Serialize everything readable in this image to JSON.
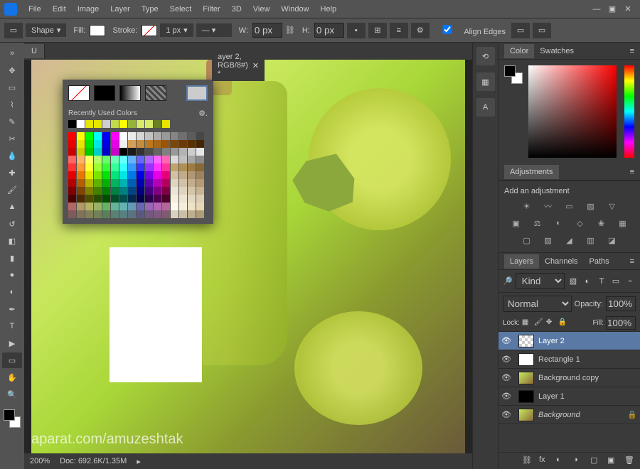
{
  "menu": {
    "items": [
      "File",
      "Edit",
      "Image",
      "Layer",
      "Type",
      "Select",
      "Filter",
      "3D",
      "View",
      "Window",
      "Help"
    ]
  },
  "options": {
    "shape_mode": "Shape",
    "fill_label": "Fill:",
    "stroke_label": "Stroke:",
    "stroke_width": "1 px",
    "w_label": "W:",
    "w_value": "0 px",
    "h_label": "H:",
    "h_value": "0 px",
    "align_edges": "Align Edges",
    "link_icon": "⛓"
  },
  "tab": {
    "title": "ayer 2, RGB/8#) *",
    "partial_prefix": "U"
  },
  "status": {
    "zoom": "200%",
    "doc": "Doc: 692.6K/1.35M"
  },
  "color_panel": {
    "tabs": [
      "Color",
      "Swatches"
    ]
  },
  "adjustments": {
    "tab": "Adjustments",
    "add_label": "Add an adjustment",
    "row1": [
      "☀",
      "〰",
      "▭",
      "▨",
      "▽"
    ],
    "row2": [
      "▣",
      "⚖",
      "◐",
      "◇",
      "❀",
      "▦"
    ],
    "row3": [
      "▢",
      "▨",
      "◢",
      "▥",
      "◪"
    ]
  },
  "layers_panel": {
    "tabs": [
      "Layers",
      "Channels",
      "Paths"
    ],
    "filter_kind": "Kind",
    "blend_mode": "Normal",
    "opacity_label": "Opacity:",
    "opacity_value": "100%",
    "lock_label": "Lock:",
    "fill_label": "Fill:",
    "fill_value": "100%",
    "layers": [
      {
        "name": "Layer 2",
        "thumb": "trans",
        "selected": true
      },
      {
        "name": "Rectangle 1",
        "thumb": "white"
      },
      {
        "name": "Background copy",
        "thumb": "img"
      },
      {
        "name": "Layer 1",
        "thumb": "dark"
      },
      {
        "name": "Background",
        "thumb": "img",
        "locked": true,
        "italic": true
      }
    ]
  },
  "color_popup": {
    "recent_label": "Recently Used Colors",
    "recent": [
      "#000000",
      "#ffffff",
      "#e6e600",
      "#e6e600",
      "#cecece",
      "#c0db4a",
      "#ffff00",
      "#95b43c",
      "#d9eb6a",
      "#d9eb6a",
      "#6a8023",
      "#e6e600"
    ],
    "palette": [
      [
        "#ff0000",
        "#ffff00",
        "#00ff00",
        "#00ffff",
        "#0000ff",
        "#ff00ff",
        "#ffffff",
        "#ebebeb",
        "#d6d6d6",
        "#c2c2c2",
        "#adadad",
        "#999999",
        "#858585",
        "#707070",
        "#5c5c5c",
        "#474747"
      ],
      [
        "#e60000",
        "#e6e600",
        "#00e600",
        "#00e6e6",
        "#0000e6",
        "#e600e6",
        "#f0f0f0",
        "#d4a056",
        "#c78d3a",
        "#b97a23",
        "#a86815",
        "#96570c",
        "#7f4608",
        "#6b3a07",
        "#573006",
        "#432505"
      ],
      [
        "#cc0000",
        "#cccc00",
        "#00cc00",
        "#00cccc",
        "#0000cc",
        "#cc00cc",
        "#000000",
        "#1a1a1a",
        "#333333",
        "#4d4d4d",
        "#666666",
        "#808080",
        "#999999",
        "#b3b3b3",
        "#cccccc",
        "#e6e6e6"
      ],
      [
        "#ff6666",
        "#ffb366",
        "#ffff66",
        "#b3ff66",
        "#66ff66",
        "#66ffb3",
        "#66ffff",
        "#66b3ff",
        "#6666ff",
        "#b366ff",
        "#ff66ff",
        "#ff66b3",
        "#d9d9d9",
        "#bfbfbf",
        "#a6a6a6",
        "#8c8c8c"
      ],
      [
        "#ff3333",
        "#ff9933",
        "#ffff33",
        "#99ff33",
        "#33ff33",
        "#33ff99",
        "#33ffff",
        "#3399ff",
        "#3333ff",
        "#9933ff",
        "#ff33ff",
        "#ff3399",
        "#c1a36a",
        "#ae8f55",
        "#9b7c43",
        "#886935"
      ],
      [
        "#e60000",
        "#e67a00",
        "#e6e600",
        "#7ae600",
        "#00e600",
        "#00e67a",
        "#00e6e6",
        "#007ae6",
        "#0000e6",
        "#7a00e6",
        "#e600e6",
        "#e6007a",
        "#d4bfa0",
        "#c2ab8a",
        "#b09775",
        "#9e8360"
      ],
      [
        "#b30000",
        "#b35f00",
        "#b3b300",
        "#5fb300",
        "#00b300",
        "#00b35f",
        "#00b3b3",
        "#005fb3",
        "#0000b3",
        "#5f00b3",
        "#b300b3",
        "#b3005f",
        "#e0d4bf",
        "#d1c1a6",
        "#c2ae8e",
        "#b39b76"
      ],
      [
        "#800000",
        "#804400",
        "#808000",
        "#448000",
        "#008000",
        "#008044",
        "#008080",
        "#004480",
        "#000080",
        "#440080",
        "#800080",
        "#800044",
        "#ece4d6",
        "#e0d4bf",
        "#d4c4a8",
        "#c8b492"
      ],
      [
        "#4d0000",
        "#4d2900",
        "#4d4d00",
        "#294d00",
        "#004d00",
        "#004d29",
        "#004d4d",
        "#00294d",
        "#00004d",
        "#29004d",
        "#4d004d",
        "#4d0029",
        "#f5efde",
        "#ece4d0",
        "#e3d9c2",
        "#dacfb4"
      ],
      [
        "#b36666",
        "#b39966",
        "#b3b366",
        "#99b366",
        "#66b366",
        "#66b399",
        "#66b3b3",
        "#6699b3",
        "#6666b3",
        "#9966b3",
        "#b366b3",
        "#b36699",
        "#fff8eb",
        "#f7edd9",
        "#efe3c7",
        "#e7d8b5"
      ],
      [
        "#805959",
        "#807359",
        "#808059",
        "#738059",
        "#598059",
        "#598073",
        "#598080",
        "#597380",
        "#595980",
        "#735980",
        "#805980",
        "#805973",
        "#d9d0bd",
        "#cbbfa6",
        "#bdae90",
        "#af9d7a"
      ]
    ]
  },
  "watermark": "aparat.com/amuzeshtak"
}
